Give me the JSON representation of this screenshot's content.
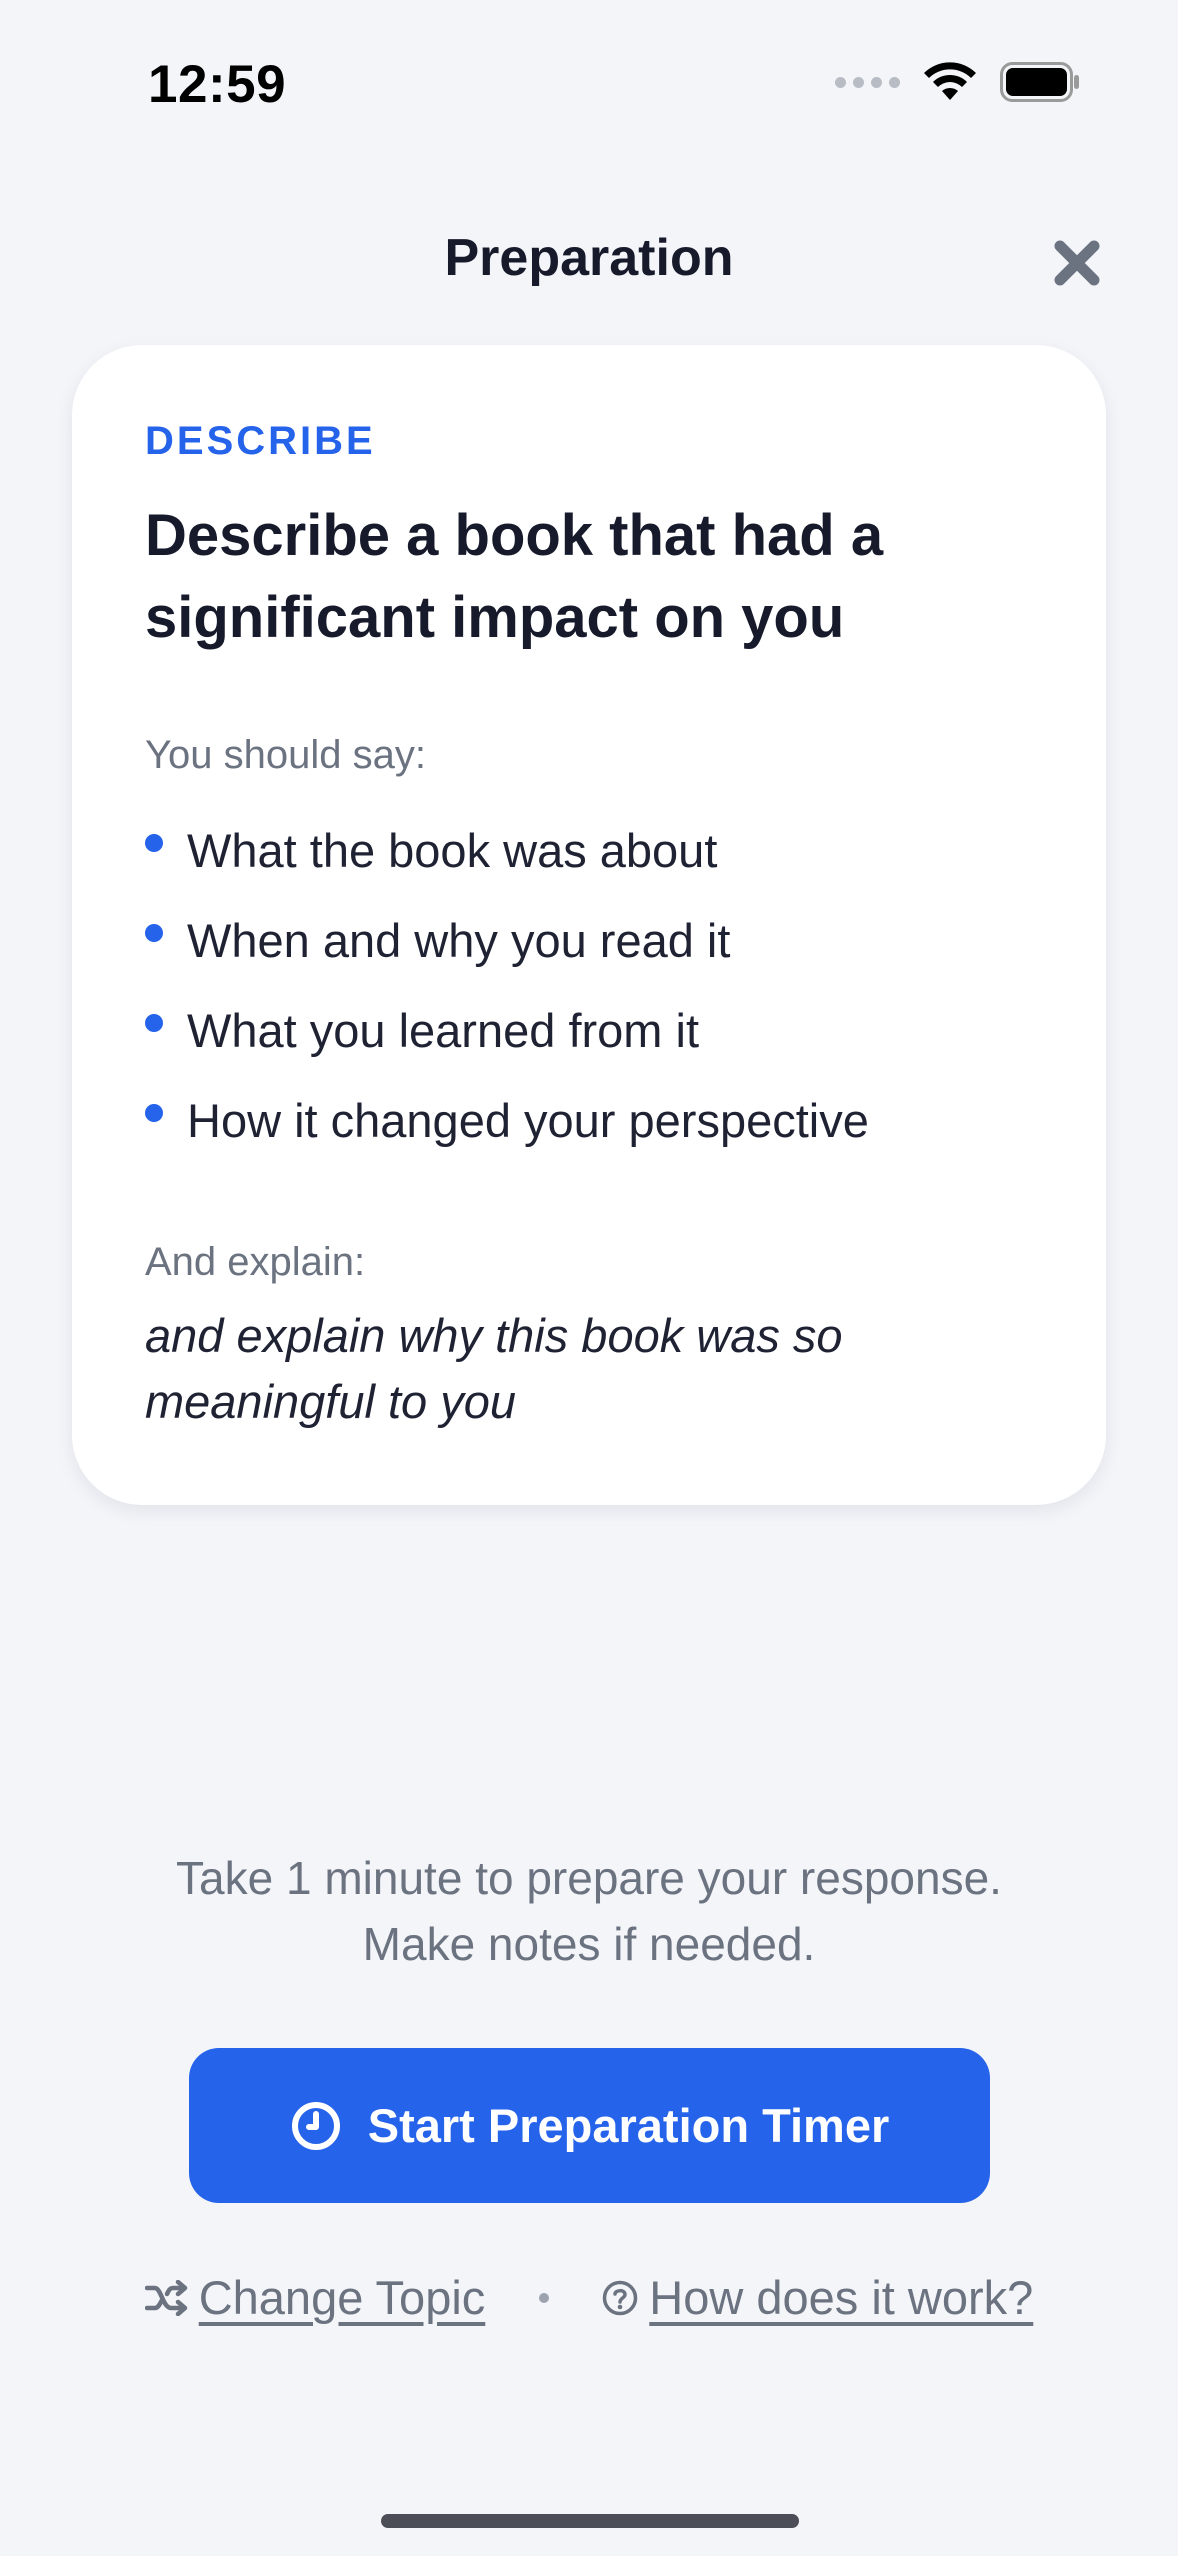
{
  "status_bar": {
    "time": "12:59"
  },
  "header": {
    "title": "Preparation",
    "close_icon": "close-x-icon"
  },
  "card": {
    "category": "DESCRIBE",
    "question": "Describe a book that had a significant impact on you",
    "should_say_label": "You should say:",
    "points": [
      "What the book was about",
      "When and why you read it",
      "What you learned from it",
      "How it changed your perspective"
    ],
    "explain_label": "And explain:",
    "explain_text": "and explain why this book was so meaningful to you"
  },
  "instructions": {
    "line1": "Take 1 minute to prepare your response.",
    "line2": "Make notes if needed."
  },
  "start_button": {
    "label": "Start Preparation Timer",
    "icon": "clock-icon"
  },
  "links": {
    "change_topic": "Change Topic",
    "change_topic_icon": "shuffle-icon",
    "how_it_works": "How does it work?",
    "how_it_works_icon": "question-circle-icon"
  },
  "colors": {
    "accent": "#2563eb",
    "background": "#f4f5f9",
    "muted_text": "#6b7280",
    "heading_text": "#161a2b"
  }
}
